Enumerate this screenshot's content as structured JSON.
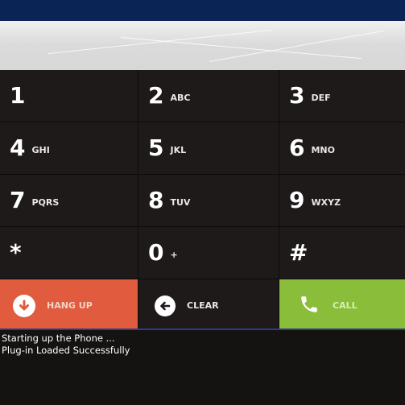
{
  "colors": {
    "titlebar": "#0a2456",
    "key_bg": "#1d1a19",
    "hangup": "#e15b3e",
    "call": "#8abd3a",
    "accent_line": "#2a3c8a"
  },
  "keypad": {
    "keys": [
      {
        "digit": "1",
        "letters": ""
      },
      {
        "digit": "2",
        "letters": "ABC"
      },
      {
        "digit": "3",
        "letters": "DEF"
      },
      {
        "digit": "4",
        "letters": "GHI"
      },
      {
        "digit": "5",
        "letters": "JKL"
      },
      {
        "digit": "6",
        "letters": "MNO"
      },
      {
        "digit": "7",
        "letters": "PQRS"
      },
      {
        "digit": "8",
        "letters": "TUV"
      },
      {
        "digit": "9",
        "letters": "WXYZ"
      },
      {
        "digit": "*",
        "letters": ""
      },
      {
        "digit": "0",
        "letters": "+"
      },
      {
        "digit": "#",
        "letters": ""
      }
    ],
    "hangup": {
      "label": "HANG UP",
      "icon": "arrow-down-circle-icon"
    },
    "clear": {
      "label": "CLEAR",
      "icon": "arrow-left-circle-icon"
    },
    "call": {
      "label": "CALL",
      "icon": "phone-handset-icon"
    }
  },
  "log": {
    "lines": [
      "Starting up the Phone ...",
      "Plug-in Loaded Successfully"
    ]
  }
}
